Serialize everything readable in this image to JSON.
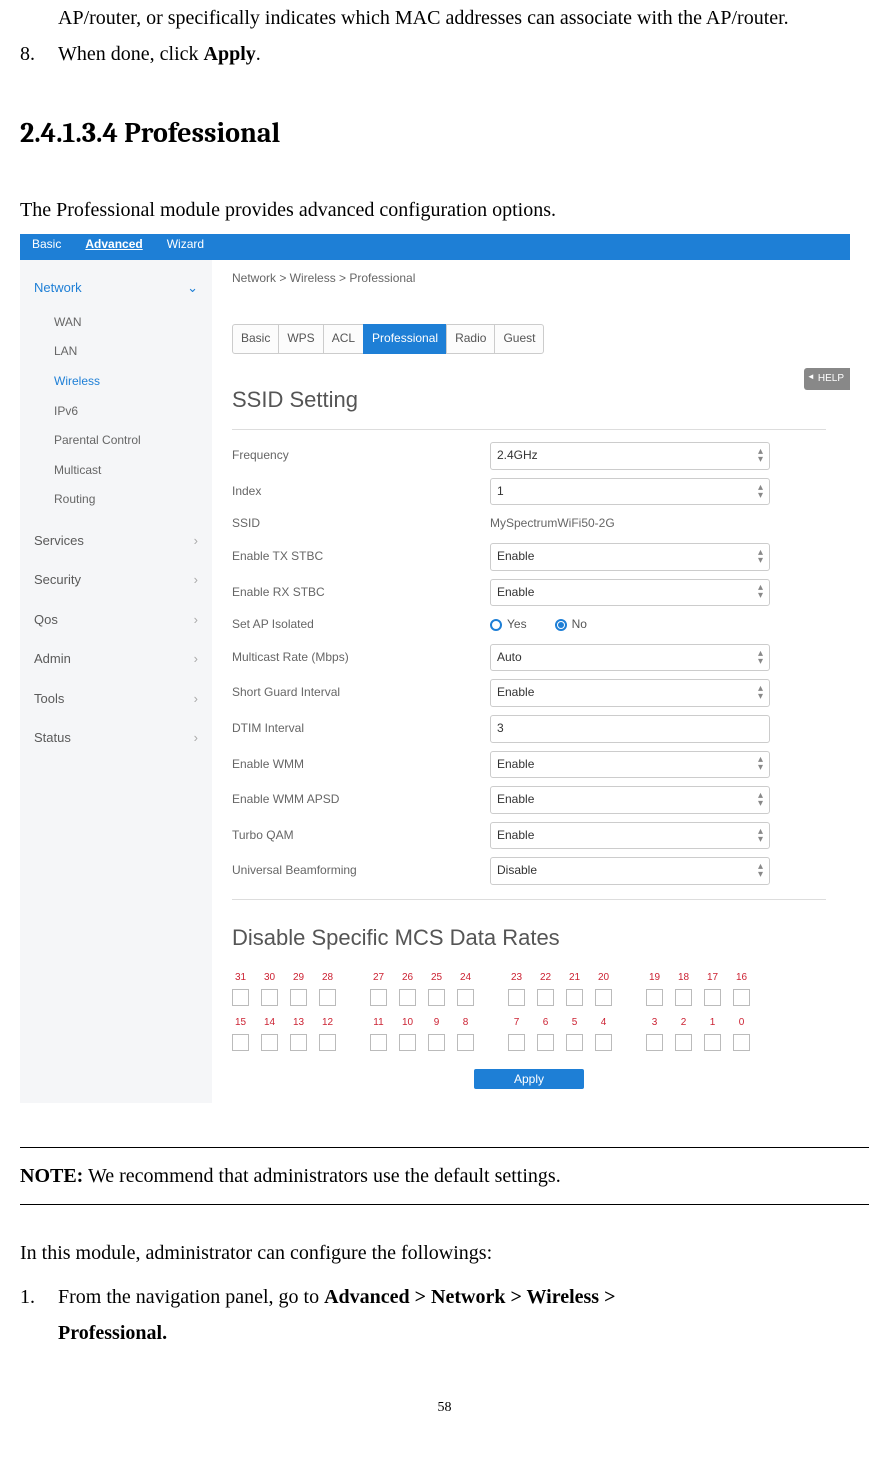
{
  "continuation": "AP/router, or specifically indicates which MAC addresses can associate with the AP/router.",
  "step8_num": "8.",
  "step8_text_a": "When done, click ",
  "step8_text_b": "Apply",
  "step8_text_c": ".",
  "heading": "2.4.1.3.4 Professional",
  "intro": "The Professional module provides advanced configuration options.",
  "screenshot": {
    "topbar": {
      "basic": "Basic",
      "advanced": "Advanced",
      "wizard": "Wizard"
    },
    "breadcrumb": "Network > Wireless > Professional",
    "help": "HELP",
    "sidebar": {
      "network": "Network",
      "sub": [
        "WAN",
        "LAN",
        "Wireless",
        "IPv6",
        "Parental Control",
        "Multicast",
        "Routing"
      ],
      "services": "Services",
      "security": "Security",
      "qos": "Qos",
      "admin": "Admin",
      "tools": "Tools",
      "status": "Status"
    },
    "tabs": [
      "Basic",
      "WPS",
      "ACL",
      "Professional",
      "Radio",
      "Guest"
    ],
    "ssid_heading": "SSID Setting",
    "fields": {
      "frequency_l": "Frequency",
      "frequency_v": "2.4GHz",
      "index_l": "Index",
      "index_v": "1",
      "ssid_l": "SSID",
      "ssid_v": "MySpectrumWiFi50-2G",
      "tx_l": "Enable TX STBC",
      "tx_v": "Enable",
      "rx_l": "Enable RX STBC",
      "rx_v": "Enable",
      "ap_l": "Set AP Isolated",
      "ap_yes": "Yes",
      "ap_no": "No",
      "mrate_l": "Multicast Rate (Mbps)",
      "mrate_v": "Auto",
      "sgi_l": "Short Guard Interval",
      "sgi_v": "Enable",
      "dtim_l": "DTIM Interval",
      "dtim_v": "3",
      "wmm_l": "Enable WMM",
      "wmm_v": "Enable",
      "apsd_l": "Enable WMM APSD",
      "apsd_v": "Enable",
      "tqam_l": "Turbo QAM",
      "tqam_v": "Enable",
      "ubf_l": "Universal Beamforming",
      "ubf_v": "Disable"
    },
    "mcs_heading": "Disable Specific MCS Data Rates",
    "mcs_row1": [
      [
        "31",
        "30",
        "29",
        "28"
      ],
      [
        "27",
        "26",
        "25",
        "24"
      ],
      [
        "23",
        "22",
        "21",
        "20"
      ],
      [
        "19",
        "18",
        "17",
        "16"
      ]
    ],
    "mcs_row2": [
      [
        "15",
        "14",
        "13",
        "12"
      ],
      [
        "11",
        "10",
        "9",
        "8"
      ],
      [
        "7",
        "6",
        "5",
        "4"
      ],
      [
        "3",
        "2",
        "1",
        "0"
      ]
    ],
    "apply": "Apply"
  },
  "note_label": "NOTE:",
  "note_text": " We recommend that administrators use the default settings.",
  "closing": "In this module, administrator can configure the followings:",
  "step1_num": "1.",
  "step1_a": "From  the  navigation  panel,  go  to ",
  "step1_b": "Advanced  >  Network  >  Wireless  >",
  "step1_c": "Professional.",
  "page_number": "58"
}
